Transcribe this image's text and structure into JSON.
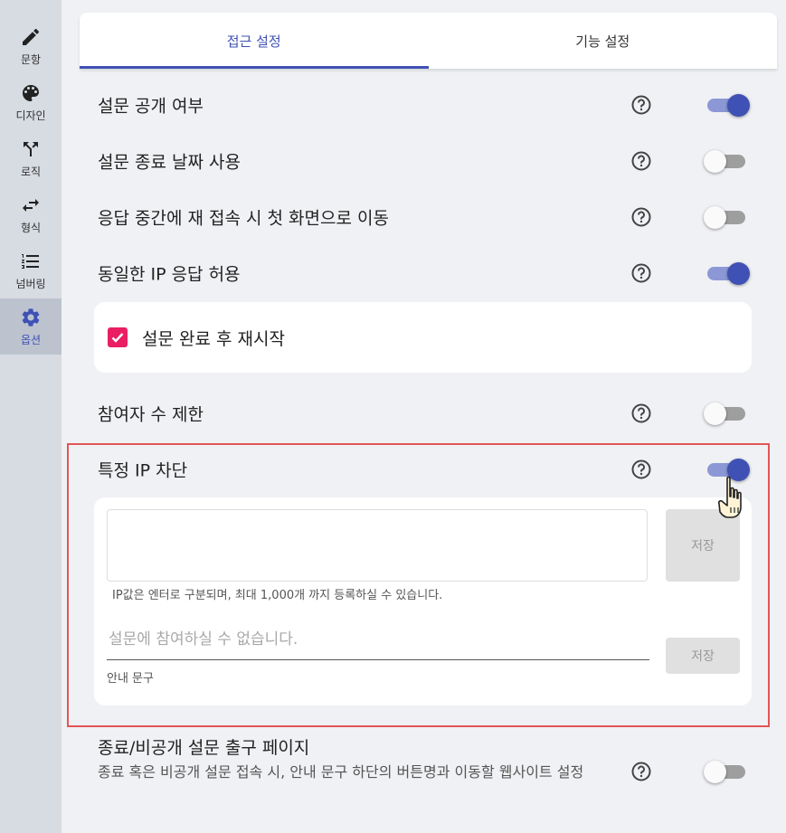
{
  "sidebar": {
    "items": [
      {
        "label": "문항",
        "icon": "pencil-icon"
      },
      {
        "label": "디자인",
        "icon": "palette-icon"
      },
      {
        "label": "로직",
        "icon": "fork-arrow-icon"
      },
      {
        "label": "형식",
        "icon": "swap-arrows-icon"
      },
      {
        "label": "넘버링",
        "icon": "numbered-list-icon"
      },
      {
        "label": "옵션",
        "icon": "gear-icon",
        "active": true
      }
    ]
  },
  "tabs": [
    {
      "label": "접근 설정",
      "active": true
    },
    {
      "label": "기능 설정",
      "active": false
    }
  ],
  "settings": {
    "public": {
      "label": "설문 공개 여부",
      "on": true
    },
    "end_date": {
      "label": "설문 종료 날짜 사용",
      "on": false
    },
    "reconnect": {
      "label": "응답 중간에 재 접속 시 첫 화면으로 이동",
      "on": false
    },
    "same_ip": {
      "label": "동일한 IP 응답 허용",
      "on": true
    },
    "restart": {
      "label": "설문 완료 후 재시작",
      "checked": true
    },
    "limit": {
      "label": "참여자 수 제한",
      "on": false
    },
    "block_ip": {
      "label": "특정 IP 차단",
      "on": true,
      "ip_save_label": "저장",
      "ip_helper": "IP값은 엔터로 구분되며, 최대 1,000개 까지 등록하실 수 있습니다.",
      "notice_placeholder": "설문에 참여하실 수 없습니다.",
      "notice_save_label": "저장",
      "notice_helper": "안내 문구"
    },
    "exit_page": {
      "label": "종료/비공개 설문 출구 페이지",
      "description": "종료 혹은 비공개 설문 접속 시, 안내 문구 하단의 버튼명과 이동할 웹사이트 설정",
      "on": false
    }
  },
  "colors": {
    "accent": "#3f51b5",
    "checkbox": "#e91e63",
    "highlight_border": "#e25555"
  }
}
